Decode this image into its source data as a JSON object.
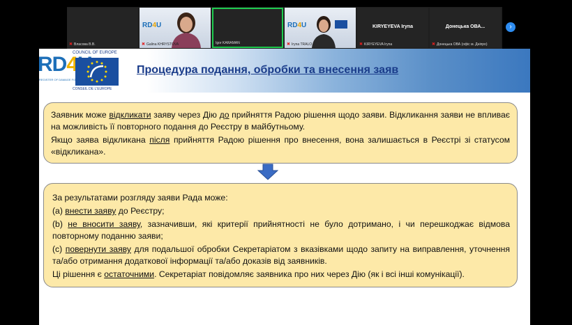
{
  "meeting": {
    "participants": [
      {
        "name": "Власова В.В.",
        "mic_muted": true
      },
      {
        "name": "Galina KHRYSTOVA",
        "mic_muted": true
      },
      {
        "name": "Igor KARAMAN",
        "mic_muted": false
      },
      {
        "name": "Iryna TRALO",
        "mic_muted": true
      },
      {
        "name": "KIRYEYEVA Iryna",
        "mic_muted": true,
        "display": "KIRYEYEVA Iryna"
      },
      {
        "name": "Донецька ОВА (офіс м. Дніпро)",
        "mic_muted": true,
        "display": "Донецька ОВА..."
      }
    ],
    "next_icon": "chevron-right-icon",
    "colors": {
      "active_speaker_border": "#1ecb4f",
      "background": "#000000",
      "tile": "#242424"
    }
  },
  "slide": {
    "logo": {
      "rd4u": "RD4U",
      "rd4u_subtitle": "REGISTER OF DAMAGE FOR UKRAINE",
      "coe_top": "COUNCIL OF EUROPE",
      "coe_bottom": "CONSEIL DE L'EUROPE"
    },
    "title": "Процедура подання, обробки та внесення заяв",
    "box1": {
      "p1_a": "Заявник може ",
      "p1_b": "відкликати",
      "p1_c": " заяву через Дію ",
      "p1_d": "до",
      "p1_e": " прийняття Радою рішення щодо заяви. Відкликання заяви не впливає на можливість її повторного подання до Реєстру в майбутньому.",
      "p2_a": "Якщо заява відкликана ",
      "p2_b": "після",
      "p2_c": " прийняття Радою рішення про внесення, вона залишається в Реєстрі зі статусом «відкликана»."
    },
    "box2": {
      "intro": "За результатами розгляду заяви Рада може:",
      "a_prefix": "(a) ",
      "a_link": "внести заяву",
      "a_rest": " до Реєстру;",
      "b_prefix": "(b) ",
      "b_link": "не вносити заяву",
      "b_rest": ", зазначивши, які критерії прийнятності не було дотримано, і чи перешкоджає відмова повторному поданню заяви;",
      "c_prefix": "(c) ",
      "c_link": "повернути заяву",
      "c_rest": " для подальшої обробки Секретаріатом з вказівками щодо запиту на виправлення, уточнення та/або отримання додаткової інформації та/або доказів від заявників.",
      "final_a": "Ці рішення є ",
      "final_b": "остаточними",
      "final_c": ". Секретаріат повідомляє заявника про них через Дію (як і всі інші комунікації)."
    },
    "arrow_icon": "arrow-down-icon",
    "colors": {
      "box_fill": "#fde9a8",
      "title": "#1a3c8a",
      "arrow": "#3b6cc4"
    }
  }
}
